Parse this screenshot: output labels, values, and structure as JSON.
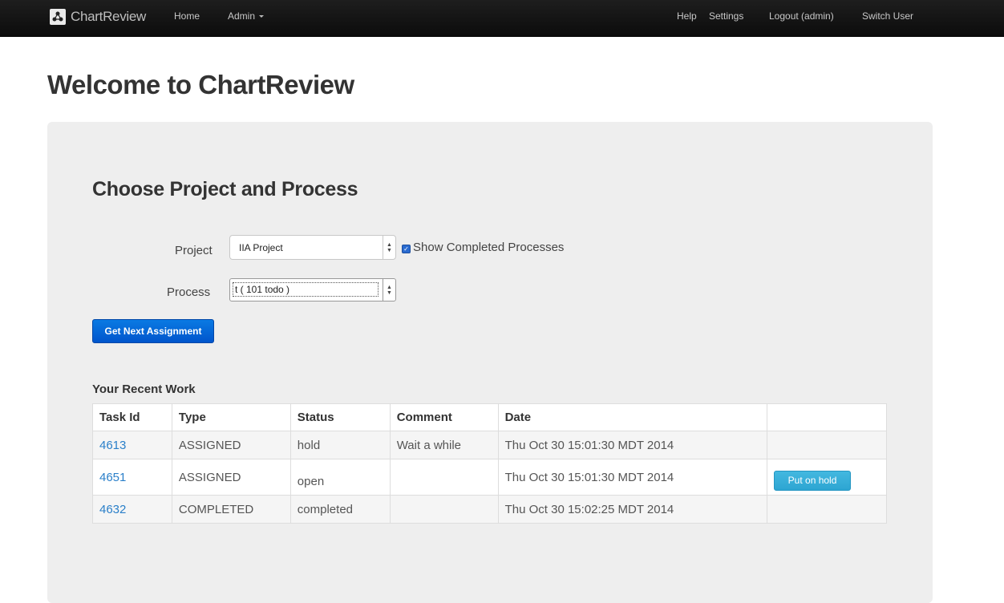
{
  "navbar": {
    "brand": "ChartReview",
    "home": "Home",
    "admin": "Admin",
    "help": "Help",
    "settings": "Settings",
    "logout": "Logout (admin)",
    "switch_user": "Switch User"
  },
  "page_title": "Welcome to ChartReview",
  "panel": {
    "title": "Choose Project and Process",
    "project_label": "Project",
    "project_value": "IIA Project",
    "show_completed_label": "Show Completed Processes",
    "show_completed_checked": true,
    "process_label": "Process",
    "process_value": "t ( 101 todo )",
    "get_next_button": "Get Next Assignment",
    "recent_title": "Your Recent Work",
    "table": {
      "headers": [
        "Task Id",
        "Type",
        "Status",
        "Comment",
        "Date",
        ""
      ],
      "rows": [
        {
          "task_id": "4613",
          "type": "ASSIGNED",
          "status": "hold",
          "comment": "Wait a while",
          "date": "Thu Oct 30 15:01:30 MDT 2014",
          "action": ""
        },
        {
          "task_id": "4651",
          "type": "ASSIGNED",
          "status": "open",
          "comment": "",
          "date": "Thu Oct 30 15:01:30 MDT 2014",
          "action": "Put on hold"
        },
        {
          "task_id": "4632",
          "type": "COMPLETED",
          "status": "completed",
          "comment": "",
          "date": "Thu Oct 30 15:02:25 MDT 2014",
          "action": ""
        }
      ]
    }
  },
  "colors": {
    "navbar_bg": "#111111",
    "primary_button": "#0066d6",
    "info_button": "#36abd8",
    "link": "#2a7fc9",
    "well_bg": "#eeeeee"
  },
  "icons": {
    "brand_logo": "chartreview-logo-icon",
    "admin_caret": "caret-down-icon",
    "select_arrow": "select-arrow-icon",
    "checkbox": "checkbox-checked-icon"
  }
}
